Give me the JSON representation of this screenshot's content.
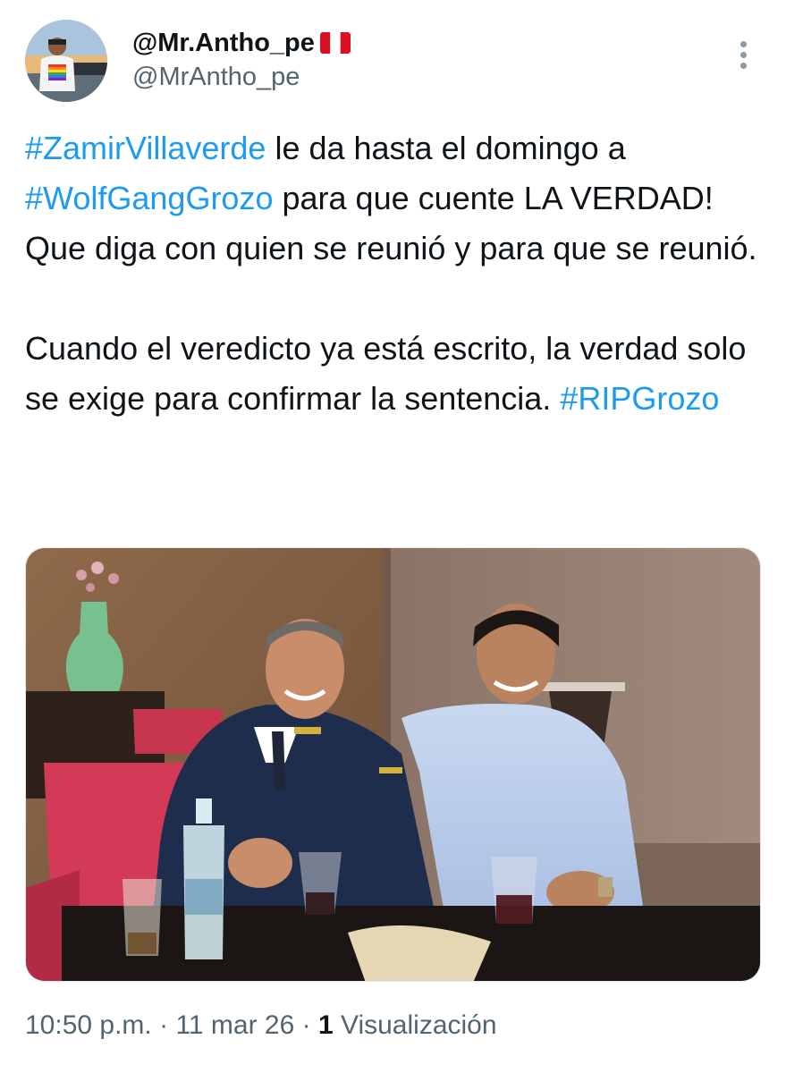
{
  "author": {
    "display_name": "@Mr.Antho_pe",
    "flag_emoji": "🇵🇪",
    "handle": "@MrAntho_pe"
  },
  "tweet": {
    "hashtag_1": "#ZamirVillaverde",
    "text_1": " le da hasta el domingo a ",
    "hashtag_2": "#WolfGangGrozo",
    "text_2": " para que cuente LA VERDAD! Que diga con quien se reunió y para que se reunió.\n\nCuando el veredicto ya está escrito, la verdad solo se exige para confirmar la sentencia. ",
    "hashtag_3": "#RIPGrozo"
  },
  "meta": {
    "time": "10:50 p.m.",
    "sep_1": " · ",
    "date": "11 mar 26",
    "sep_2": " · ",
    "views_count": "1",
    "views_label": " Visualización"
  },
  "colors": {
    "hashtag": "#1d9bf0",
    "text": "#0f1419",
    "secondary": "#536471"
  },
  "icons": {
    "more": "more-options-vertical-icon",
    "flag": "peru-flag-icon"
  }
}
